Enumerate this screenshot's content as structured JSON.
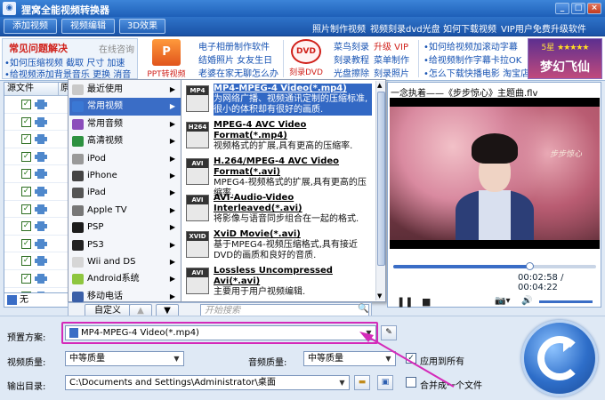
{
  "app": {
    "title": "狸窝全能视频转换器"
  },
  "window_buttons": [
    "_",
    "□",
    "×"
  ],
  "toolbar": {
    "buttons": [
      "添加视频",
      "视频编辑",
      "3D效果"
    ],
    "links": [
      "照片制作视频",
      "视频刻录dvd光盘",
      "如何下载视频",
      "VIP用户免费升级软件"
    ]
  },
  "ads": {
    "faq_title": "常见问题解决",
    "faq_consult": "在线咨询",
    "faq_line1": "•如何压缩视频 截取 尺寸 加速",
    "faq_line2": "•给视频添加背景音乐 更换 消音",
    "ppt_caption": "PPT转视频",
    "ppt_logo": "P",
    "col2": [
      "电子相册制作软件",
      "结婚照片 女友生日",
      "老婆在家无聊怎么办"
    ],
    "dvd_caption": "刻录DVD",
    "dvd_logo": "DVD",
    "col3a": [
      "菜鸟刻录",
      "刻录教程",
      "光盘擦除"
    ],
    "col3b": [
      "升级 VIP",
      "菜单制作",
      "刻录照片"
    ],
    "col4": [
      "•如何给视频加滚动字幕",
      "•给视频制作字幕卡拉OK",
      "•怎么下载快播电影 淘宝店"
    ],
    "game_rank": "5星",
    "game_stars": "★★★★★",
    "game_name": "梦幻飞仙"
  },
  "left_panel": {
    "header": "源文件",
    "header2": "原",
    "row_count": 12,
    "footer": "无"
  },
  "categories": [
    {
      "label": "最近使用",
      "color": "#c9c9c9"
    },
    {
      "label": "常用视频",
      "color": "#3a78d4",
      "selected": true
    },
    {
      "label": "常用音频",
      "color": "#8b4dbb"
    },
    {
      "label": "高清视频",
      "color": "#2d9140"
    },
    {
      "label": "iPod",
      "color": "#999999"
    },
    {
      "label": "iPhone",
      "color": "#444444"
    },
    {
      "label": "iPad",
      "color": "#555555"
    },
    {
      "label": "Apple TV",
      "color": "#777777"
    },
    {
      "label": "PSP",
      "color": "#1c1c1c"
    },
    {
      "label": "PS3",
      "color": "#222222"
    },
    {
      "label": "Wii and DS",
      "color": "#d6d6d6"
    },
    {
      "label": "Android系统",
      "color": "#8ec63f"
    },
    {
      "label": "移动电话",
      "color": "#3a5fa8"
    }
  ],
  "formats": [
    {
      "icon": "MP4",
      "name": "MP4-MPEG-4 Video(*.mp4)",
      "desc": "为网络广播、视频通讯定制的压缩标准,很小的体积却有很好的画质.",
      "selected": true
    },
    {
      "icon": "H264",
      "name": "MPEG-4 AVC Video Format(*.mp4)",
      "desc": "视频格式的扩展,具有更高的压缩率."
    },
    {
      "icon": "AVI",
      "name": "H.264/MPEG-4 AVC Video Format(*.avi)",
      "desc": "MPEG4-视频格式的扩展,具有更高的压缩率."
    },
    {
      "icon": "AVI",
      "name": "AVI-Audio-Video Interleaved(*.avi)",
      "desc": "将影像与语音同步组合在一起的格式."
    },
    {
      "icon": "XVID",
      "name": "XviD Movie(*.avi)",
      "desc": "基于MPEG4-视频压缩格式,具有接近DVD的画质和良好的音质."
    },
    {
      "icon": "AVI",
      "name": "Lossless Uncompressed Avi(*.avi)",
      "desc": "主要用于用户视频编辑."
    }
  ],
  "format_bottom": {
    "custom": "自定义",
    "up": "▲",
    "down": "▼",
    "search_placeholder": "开始搜索",
    "search_icon": "🔍"
  },
  "preview": {
    "title": "一念执着——《步步惊心》主题曲.flv",
    "calligraphy": "步步惊心",
    "progress": 0.67,
    "play_icon": "❚❚",
    "stop_icon": "■",
    "snapshot_icon": "📷▾",
    "time": "00:02:58 / 00:04:22",
    "volume_icon": "🔊"
  },
  "settings": {
    "preset_label": "预置方案:",
    "preset_value": "MP4-MPEG-4 Video(*.mp4)",
    "video_quality_label": "视频质量:",
    "video_quality": "中等质量",
    "audio_quality_label": "音频质量:",
    "audio_quality": "中等质量",
    "apply_all": "应用到所有",
    "apply_all_checked": true,
    "output_label": "输出目录:",
    "output_path": "C:\\Documents and Settings\\Administrator\\桌面",
    "merge": "合并成一个文件",
    "merge_checked": false
  },
  "colors": {
    "highlight": "#d42ab9",
    "selected": "#3268c4",
    "titlebar": "#1e5fb8"
  }
}
